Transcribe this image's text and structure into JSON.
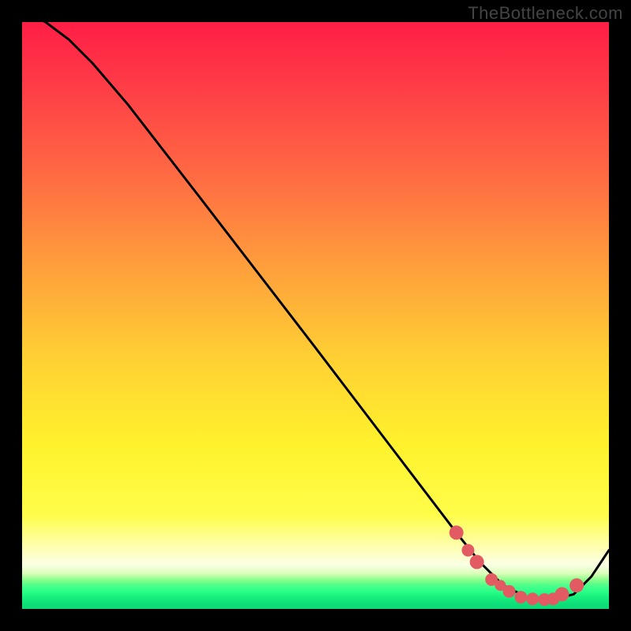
{
  "watermark": "TheBottleneck.com",
  "colors": {
    "frame": "#000000",
    "gradient_top": "#ff1e46",
    "gradient_mid": "#fff22c",
    "gradient_bottom": "#0cd878",
    "curve": "#000000",
    "markers": "#e35b62"
  },
  "chart_data": {
    "type": "line",
    "title": "",
    "xlabel": "",
    "ylabel": "",
    "xlim": [
      0,
      1
    ],
    "ylim": [
      0,
      1
    ],
    "x": [
      0.0,
      0.04,
      0.08,
      0.12,
      0.18,
      0.3,
      0.5,
      0.66,
      0.74,
      0.78,
      0.82,
      0.86,
      0.9,
      0.94,
      0.97,
      1.0
    ],
    "y": [
      1.02,
      1.0,
      0.97,
      0.93,
      0.86,
      0.705,
      0.445,
      0.235,
      0.13,
      0.08,
      0.04,
      0.02,
      0.015,
      0.025,
      0.055,
      0.1
    ],
    "series": [
      {
        "name": "curve",
        "x": [
          0.0,
          0.04,
          0.08,
          0.12,
          0.18,
          0.3,
          0.5,
          0.66,
          0.74,
          0.78,
          0.82,
          0.86,
          0.9,
          0.94,
          0.97,
          1.0
        ],
        "y": [
          1.02,
          1.0,
          0.97,
          0.93,
          0.86,
          0.705,
          0.445,
          0.235,
          0.13,
          0.08,
          0.04,
          0.02,
          0.015,
          0.025,
          0.055,
          0.1
        ]
      }
    ],
    "markers": {
      "x": [
        0.74,
        0.76,
        0.775,
        0.8,
        0.815,
        0.83,
        0.85,
        0.87,
        0.89,
        0.905,
        0.92,
        0.945
      ],
      "y": [
        0.13,
        0.1,
        0.08,
        0.05,
        0.04,
        0.03,
        0.02,
        0.017,
        0.016,
        0.017,
        0.025,
        0.04
      ],
      "r": [
        9,
        8,
        9,
        8,
        7,
        8,
        8,
        8,
        8,
        8,
        9,
        9
      ]
    }
  }
}
